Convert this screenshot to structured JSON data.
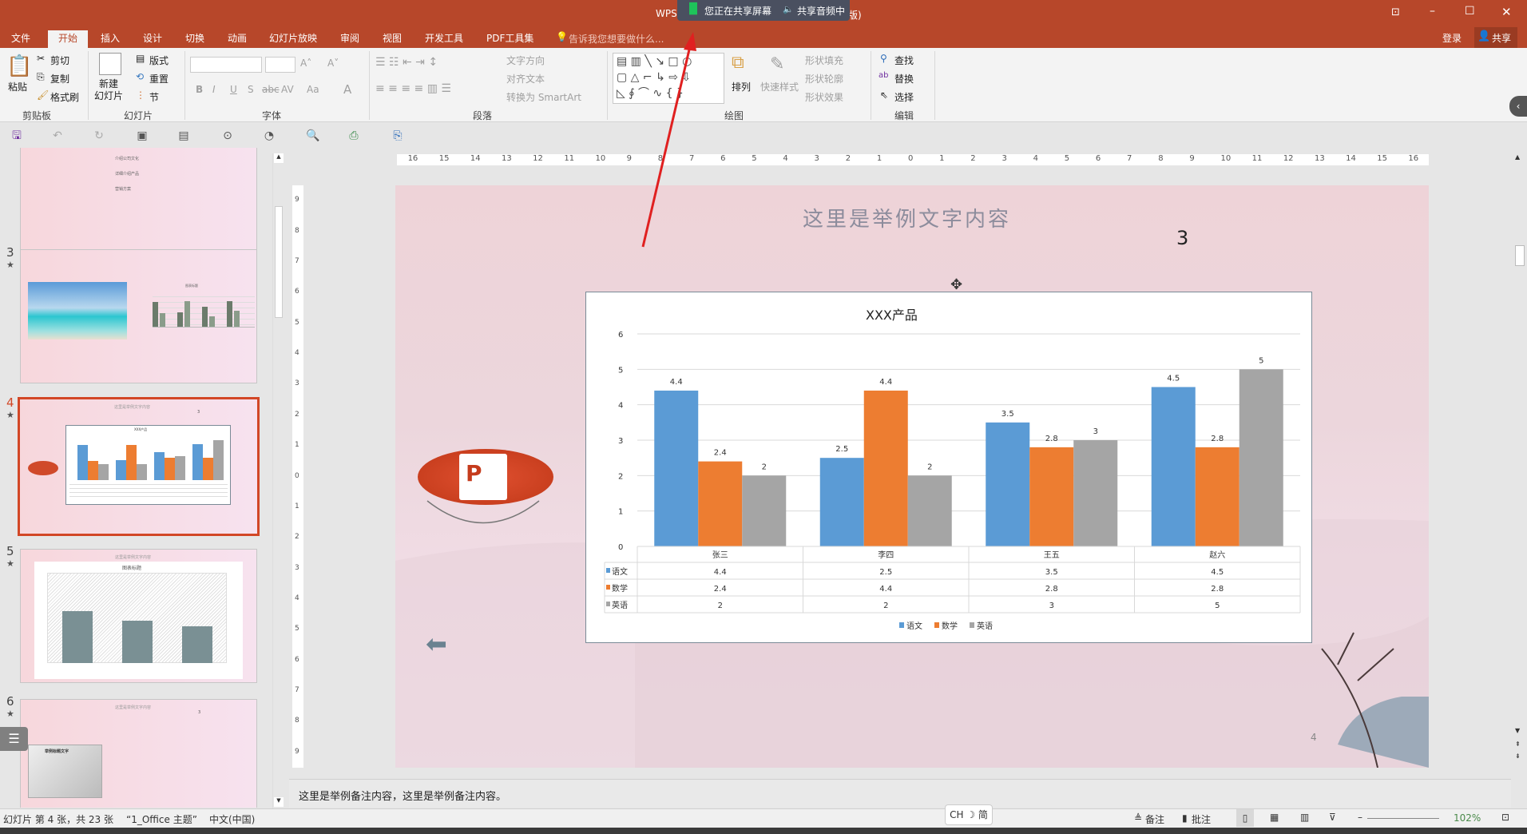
{
  "titlebar": {
    "app": "WPS",
    "share_screen": "您正在共享屏幕",
    "share_audio": "共享音频中",
    "trailing": "版)"
  },
  "tabs": [
    "文件",
    "开始",
    "插入",
    "设计",
    "切换",
    "动画",
    "幻灯片放映",
    "审阅",
    "视图",
    "开发工具",
    "PDF工具集"
  ],
  "active_tab": "开始",
  "tell_me": "告诉我您想要做什么...",
  "login": "登录",
  "share": "共享",
  "ribbon": {
    "clipboard": {
      "paste": "粘贴",
      "cut": "剪切",
      "copy": "复制",
      "format_painter": "格式刷",
      "label": "剪贴板"
    },
    "slides": {
      "new_slide": "新建\n幻灯片",
      "layout": "版式",
      "reset": "重置",
      "section": "节",
      "label": "幻灯片"
    },
    "font": {
      "label": "字体",
      "bold": "B",
      "italic": "I",
      "underline": "U",
      "shadow": "S",
      "strike": "abc",
      "spacing": "AV",
      "case": "Aa",
      "color": "A"
    },
    "paragraph": {
      "text_direction": "文字方向",
      "align_text": "对齐文本",
      "smartart": "转换为 SmartArt",
      "label": "段落"
    },
    "drawing": {
      "arrange": "排列",
      "quick_styles": "快速样式",
      "shape_fill": "形状填充",
      "shape_outline": "形状轮廓",
      "shape_effects": "形状效果",
      "label": "绘图"
    },
    "editing": {
      "find": "查找",
      "replace": "替换",
      "select": "选择",
      "label": "编辑"
    }
  },
  "ruler_h": [
    "16",
    "15",
    "14",
    "13",
    "12",
    "11",
    "10",
    "9",
    "8",
    "7",
    "6",
    "5",
    "4",
    "3",
    "2",
    "1",
    "0",
    "1",
    "2",
    "3",
    "4",
    "5",
    "6",
    "7",
    "8",
    "9",
    "10",
    "11",
    "12",
    "13",
    "14",
    "15",
    "16"
  ],
  "ruler_v": [
    "9",
    "8",
    "7",
    "6",
    "5",
    "4",
    "3",
    "2",
    "1",
    "0",
    "1",
    "2",
    "3",
    "4",
    "5",
    "6",
    "7",
    "8",
    "9"
  ],
  "thumbnails": [
    {
      "num": "",
      "lines": [
        "介绍公司文化",
        "详细介绍产品",
        "营销方案"
      ]
    },
    {
      "num": "3",
      "chart_title": "图表标题"
    },
    {
      "num": "4",
      "title": "这里是举例文字内容",
      "sub": "3",
      "chart_title": "XXX产品"
    },
    {
      "num": "5",
      "title": "这里是举例文字内容",
      "chart_title": "图表标题"
    },
    {
      "num": "6",
      "title": "这里是举例文字内容",
      "sub": "3",
      "chart_title": "举例标题文字"
    }
  ],
  "slide": {
    "title": "这里是举例文字内容",
    "subtitle": "3",
    "page_number": "4",
    "logo_text": "P"
  },
  "chart_data": {
    "type": "bar",
    "title": "XXX产品",
    "categories": [
      "张三",
      "李四",
      "王五",
      "赵六"
    ],
    "series": [
      {
        "name": "语文",
        "values": [
          4.4,
          2.5,
          3.5,
          4.5
        ],
        "color": "#5b9bd5"
      },
      {
        "name": "数学",
        "values": [
          2.4,
          4.4,
          2.8,
          2.8
        ],
        "color": "#ed7d31"
      },
      {
        "name": "英语",
        "values": [
          2,
          2,
          3,
          5
        ],
        "color": "#a5a5a5"
      }
    ],
    "ylim": [
      0,
      6
    ],
    "yticks": [
      0,
      1,
      2,
      3,
      4,
      5,
      6
    ],
    "grid": true,
    "data_table": true,
    "legend": "bottom",
    "data_labels": true
  },
  "notes": "这里是举例备注内容，这里是举例备注内容。",
  "status": {
    "slide_info": "幻灯片 第 4 张，共 23 张",
    "theme": "“1_Office 主题”",
    "language": "中文(中国)",
    "ime": "CH ☽ 简",
    "notes": "备注",
    "comments": "批注",
    "zoom": "102%"
  },
  "colors": {
    "accent": "#b7472a",
    "selected": "#d24726"
  }
}
